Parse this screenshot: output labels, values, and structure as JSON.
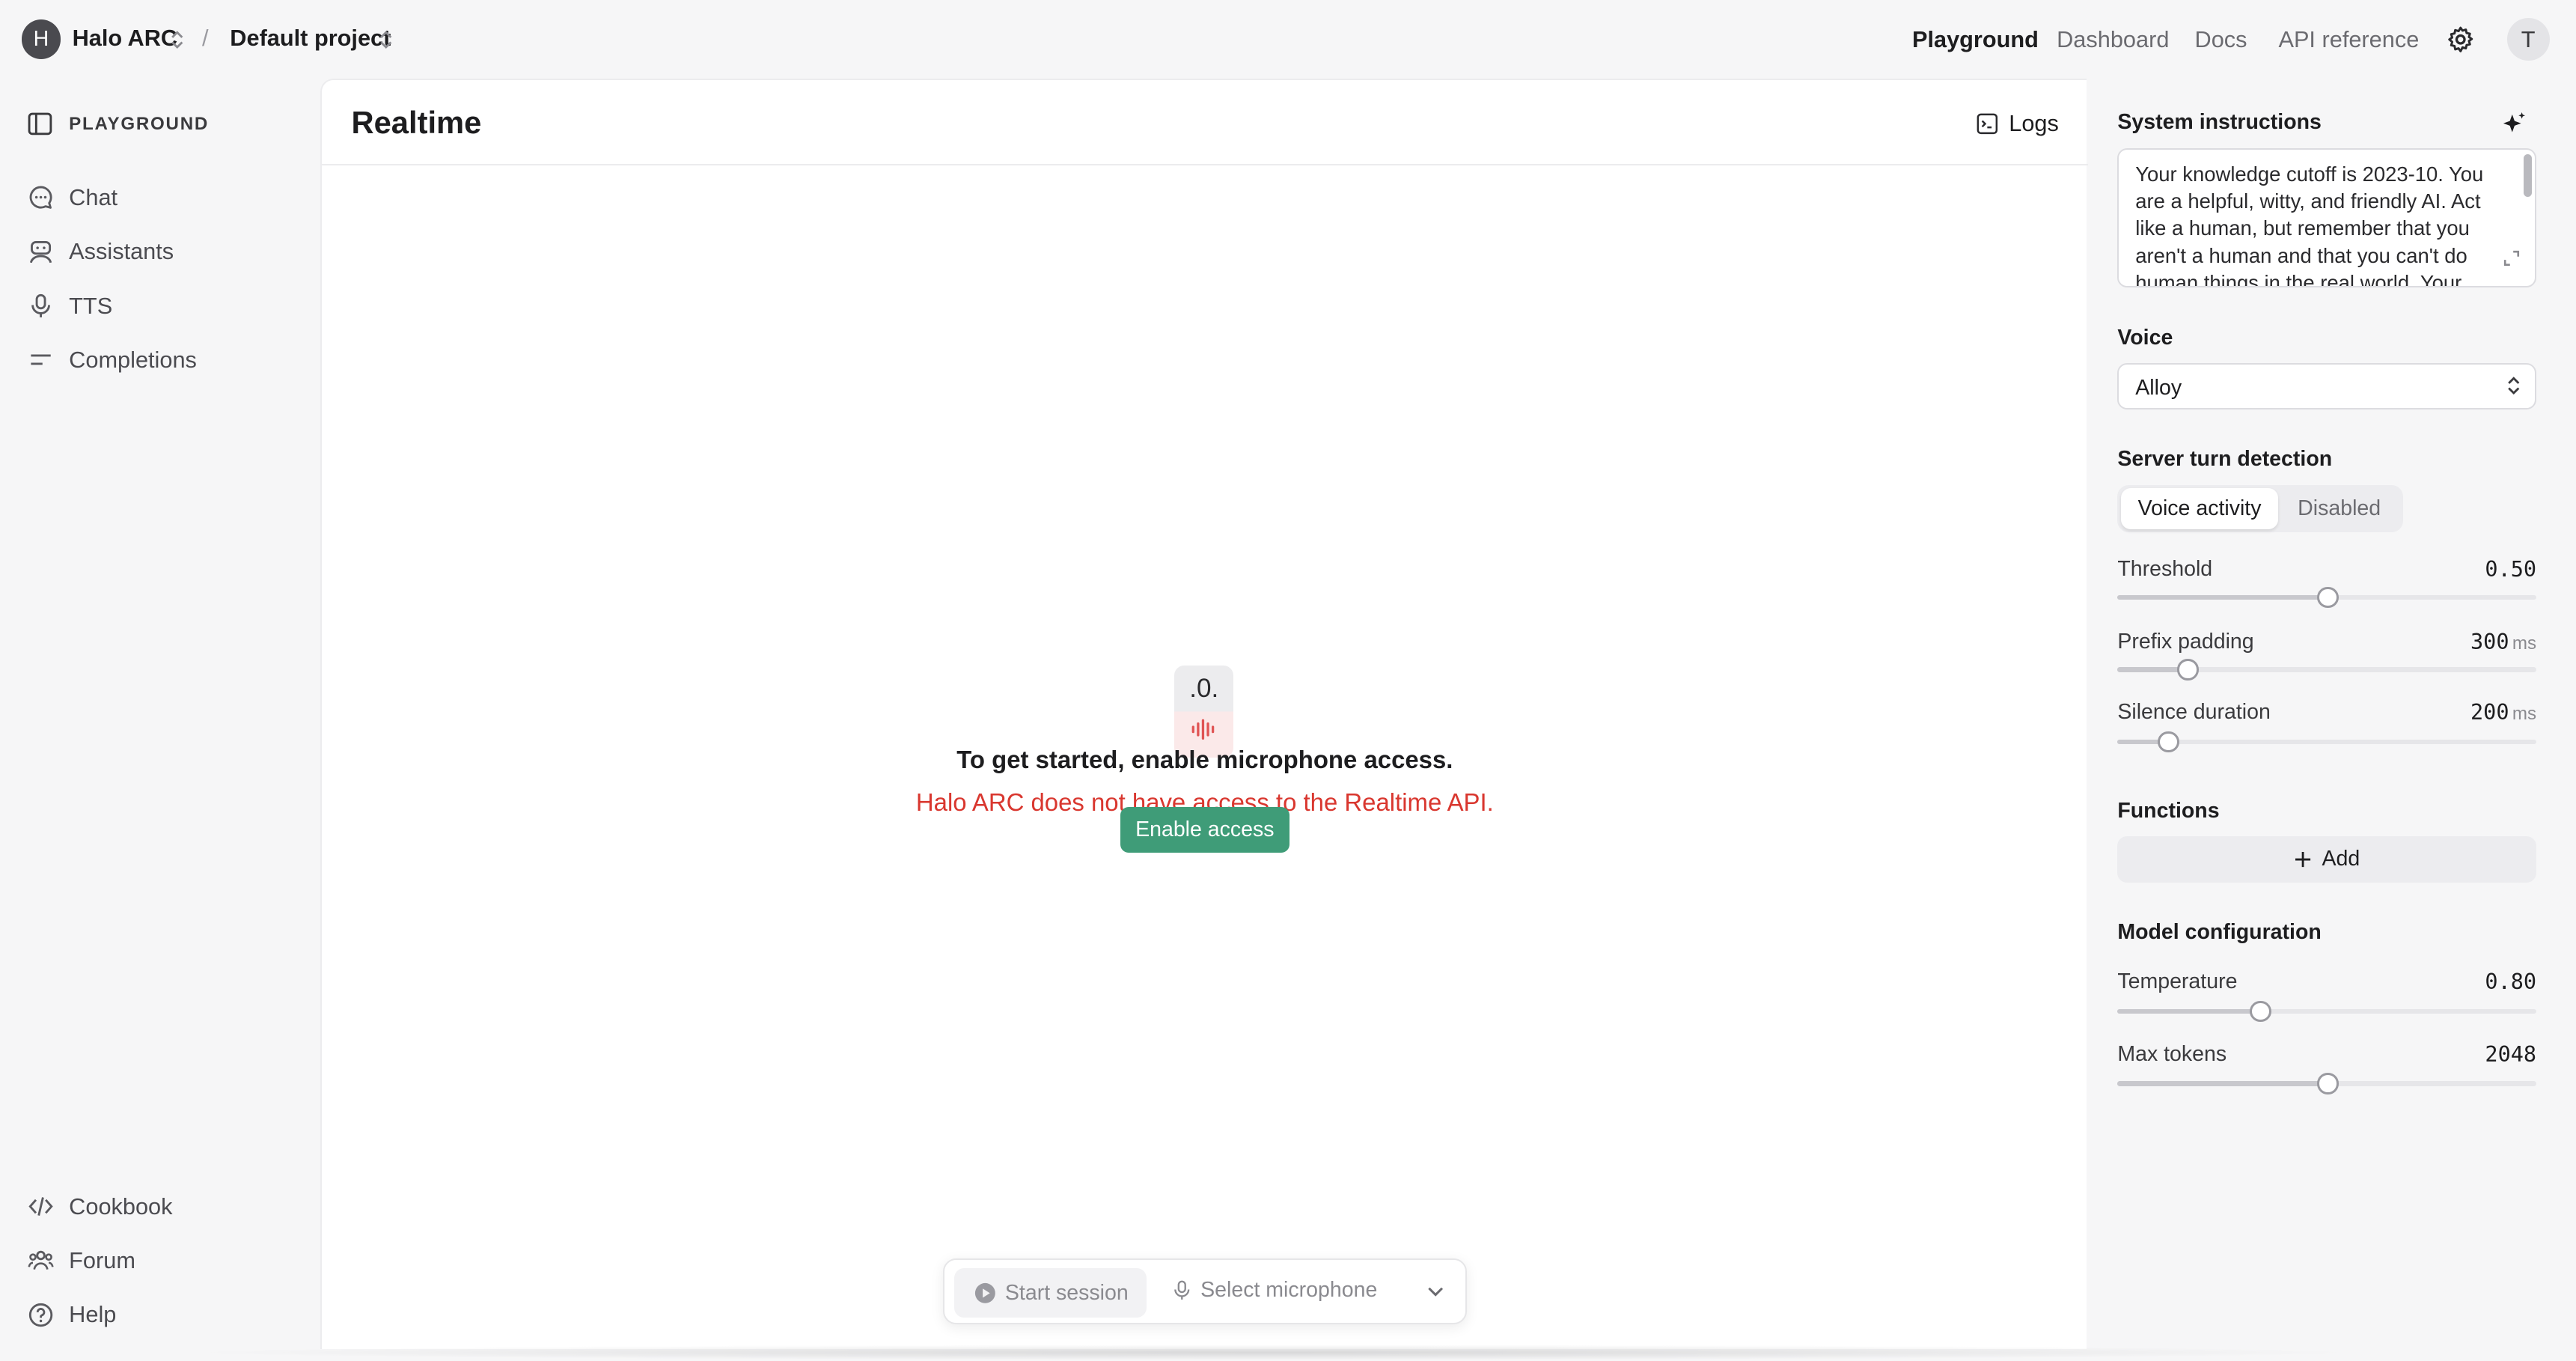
{
  "header": {
    "org_initial": "H",
    "org_name": "Halo ARC",
    "separator": "/",
    "project_name": "Default project",
    "nav": [
      "Playground",
      "Dashboard",
      "Docs",
      "API reference"
    ],
    "active_nav": "Playground",
    "user_initial": "T"
  },
  "sidebar": {
    "heading": "PLAYGROUND",
    "items": [
      {
        "label": "Chat",
        "icon": "chat-icon"
      },
      {
        "label": "Assistants",
        "icon": "assistant-icon"
      },
      {
        "label": "TTS",
        "icon": "microphone-icon"
      },
      {
        "label": "Completions",
        "icon": "completions-icon"
      }
    ],
    "footer_items": [
      {
        "label": "Cookbook",
        "icon": "code-icon"
      },
      {
        "label": "Forum",
        "icon": "users-icon"
      },
      {
        "label": "Help",
        "icon": "help-icon"
      }
    ]
  },
  "main": {
    "title": "Realtime",
    "logs_label": "Logs",
    "badge_text": ".0.",
    "message_primary": "To get started, enable microphone access.",
    "message_error": "Halo ARC does not have access to the Realtime API.",
    "enable_button": "Enable access",
    "start_session": "Start session",
    "select_microphone": "Select microphone"
  },
  "settings": {
    "system_instructions_label": "System instructions",
    "system_instructions": "Your knowledge cutoff is 2023-10. You are a helpful, witty, and friendly AI. Act like a human, but remember that you aren't a human and that you can't do human things in the real world. Your",
    "voice_label": "Voice",
    "voice_value": "Alloy",
    "turn_detection_label": "Server turn detection",
    "turn_options": [
      "Voice activity",
      "Disabled"
    ],
    "turn_selected": "Voice activity",
    "threshold": {
      "label": "Threshold",
      "value": "0.50",
      "fraction": 0.5
    },
    "prefix_padding": {
      "label": "Prefix padding",
      "value": "300",
      "unit": "ms",
      "fraction": 0.167
    },
    "silence_duration": {
      "label": "Silence duration",
      "value": "200",
      "unit": "ms",
      "fraction": 0.12
    },
    "functions_label": "Functions",
    "add_label": "Add",
    "model_config_label": "Model configuration",
    "temperature": {
      "label": "Temperature",
      "value": "0.80",
      "fraction": 0.34
    },
    "max_tokens": {
      "label": "Max tokens",
      "value": "2048",
      "fraction": 0.5
    }
  },
  "colors": {
    "accent_green": "#3f9c78",
    "error_red": "#d9372f",
    "page_bg": "#f6f6f7"
  }
}
